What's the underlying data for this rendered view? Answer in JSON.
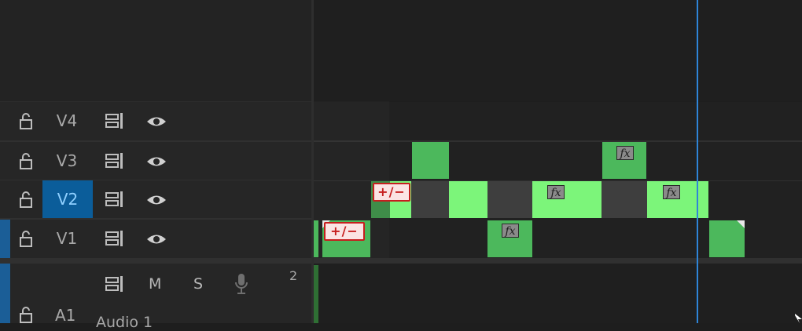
{
  "tracks": {
    "video": [
      {
        "label": "V4"
      },
      {
        "label": "V3"
      },
      {
        "label": "V2"
      },
      {
        "label": "V1"
      }
    ],
    "audio": {
      "label": "A1",
      "name": "Audio 1",
      "mute": "M",
      "solo": "S",
      "badge": "2"
    }
  },
  "clip_labels": {
    "fx": "fx",
    "keyframe": "+/−"
  },
  "colors": {
    "accent_blue": "#0b5d9a",
    "playhead": "#2e85d8",
    "clip_green": "#4cb85c",
    "clip_light_green": "#7cf57a",
    "keyframe_red": "#c61e1e"
  },
  "icons": {
    "lock": "lock-icon",
    "sync": "sync-lock-icon",
    "eye": "eye-icon",
    "mic": "microphone-icon"
  }
}
